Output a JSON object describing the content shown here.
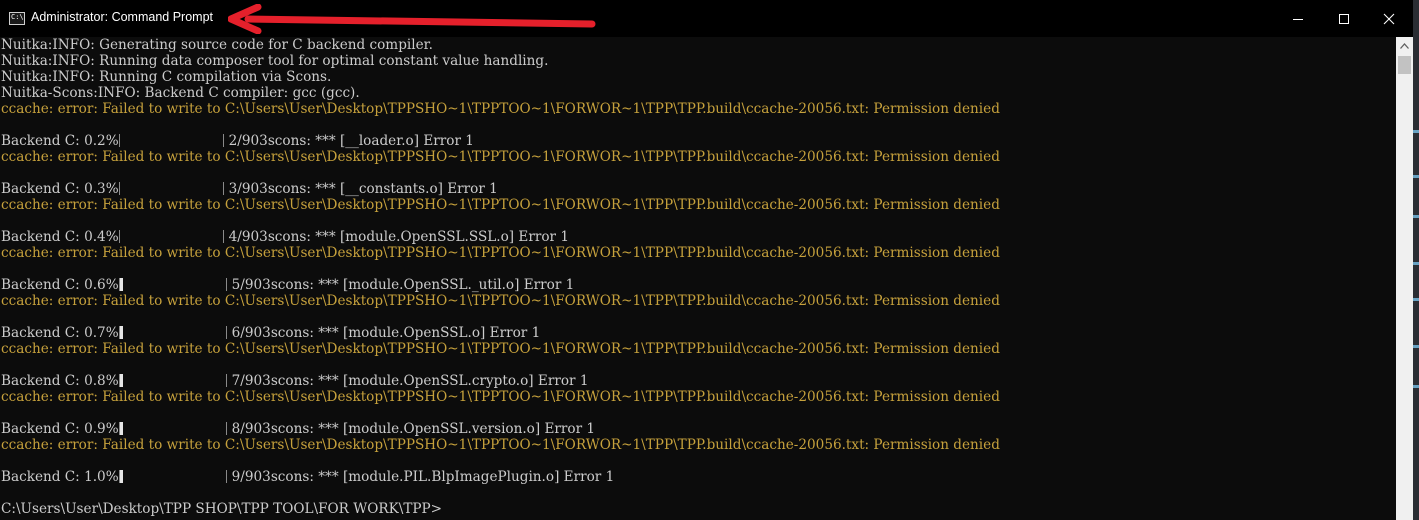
{
  "window": {
    "title": "Administrator: Command Prompt",
    "icon": "cmd-icon",
    "icon_text": "C:\\",
    "controls": [
      "minimize-icon",
      "maximize-icon",
      "close-icon"
    ]
  },
  "annotation": {
    "arrow_color": "#e5202b"
  },
  "colors": {
    "console_bg": "#0c0c0c",
    "console_text": "#cccccc",
    "error_text": "#c6a13c",
    "titlebar_bg": "#000000"
  },
  "console": {
    "lines": [
      {
        "kind": "info",
        "text": "Nuitka:INFO: Generating source code for C backend compiler."
      },
      {
        "kind": "info",
        "text": "Nuitka:INFO: Running data composer tool for optimal constant value handling."
      },
      {
        "kind": "info",
        "text": "Nuitka:INFO: Running C compilation via Scons."
      },
      {
        "kind": "info",
        "text": "Nuitka-Scons:INFO: Backend C compiler: gcc (gcc)."
      },
      {
        "kind": "error",
        "text": "ccache: error: Failed to write to C:\\Users\\User\\Desktop\\TPPSHO~1\\TPPTOO~1\\FORWOR~1\\TPP\\TPP.build\\ccache-20056.txt: Permission denied"
      },
      {
        "kind": "blank",
        "text": ""
      },
      {
        "kind": "progress",
        "label": "Backend C: 0.2%",
        "fill": 0.002,
        "pad": "                        ",
        "suffix": "2/903scons: *** [__loader.o] Error 1"
      },
      {
        "kind": "error",
        "text": "ccache: error: Failed to write to C:\\Users\\User\\Desktop\\TPPSHO~1\\TPPTOO~1\\FORWOR~1\\TPP\\TPP.build\\ccache-20056.txt: Permission denied"
      },
      {
        "kind": "blank",
        "text": ""
      },
      {
        "kind": "progress",
        "label": "Backend C: 0.3%",
        "fill": 0.003,
        "pad": "                        ",
        "suffix": "3/903scons: *** [__constants.o] Error 1"
      },
      {
        "kind": "error",
        "text": "ccache: error: Failed to write to C:\\Users\\User\\Desktop\\TPPSHO~1\\TPPTOO~1\\FORWOR~1\\TPP\\TPP.build\\ccache-20056.txt: Permission denied"
      },
      {
        "kind": "blank",
        "text": ""
      },
      {
        "kind": "progress",
        "label": "Backend C: 0.4%",
        "fill": 0.004,
        "pad": "                        ",
        "suffix": "4/903scons: *** [module.OpenSSL.SSL.o] Error 1"
      },
      {
        "kind": "error",
        "text": "ccache: error: Failed to write to C:\\Users\\User\\Desktop\\TPPSHO~1\\TPPTOO~1\\FORWOR~1\\TPP\\TPP.build\\ccache-20056.txt: Permission denied"
      },
      {
        "kind": "blank",
        "text": ""
      },
      {
        "kind": "progress",
        "label": "Backend C: 0.6%",
        "fill": 0.006,
        "pad": "                        ",
        "suffix": "5/903scons: *** [module.OpenSSL._util.o] Error 1"
      },
      {
        "kind": "error",
        "text": "ccache: error: Failed to write to C:\\Users\\User\\Desktop\\TPPSHO~1\\TPPTOO~1\\FORWOR~1\\TPP\\TPP.build\\ccache-20056.txt: Permission denied"
      },
      {
        "kind": "blank",
        "text": ""
      },
      {
        "kind": "progress",
        "label": "Backend C: 0.7%",
        "fill": 0.007,
        "pad": "                        ",
        "suffix": "6/903scons: *** [module.OpenSSL.o] Error 1"
      },
      {
        "kind": "error",
        "text": "ccache: error: Failed to write to C:\\Users\\User\\Desktop\\TPPSHO~1\\TPPTOO~1\\FORWOR~1\\TPP\\TPP.build\\ccache-20056.txt: Permission denied"
      },
      {
        "kind": "blank",
        "text": ""
      },
      {
        "kind": "progress",
        "label": "Backend C: 0.8%",
        "fill": 0.008,
        "pad": "                        ",
        "suffix": "7/903scons: *** [module.OpenSSL.crypto.o] Error 1"
      },
      {
        "kind": "error",
        "text": "ccache: error: Failed to write to C:\\Users\\User\\Desktop\\TPPSHO~1\\TPPTOO~1\\FORWOR~1\\TPP\\TPP.build\\ccache-20056.txt: Permission denied"
      },
      {
        "kind": "blank",
        "text": ""
      },
      {
        "kind": "progress",
        "label": "Backend C: 0.9%",
        "fill": 0.009,
        "pad": "                        ",
        "suffix": "8/903scons: *** [module.OpenSSL.version.o] Error 1"
      },
      {
        "kind": "error",
        "text": "ccache: error: Failed to write to C:\\Users\\User\\Desktop\\TPPSHO~1\\TPPTOO~1\\FORWOR~1\\TPP\\TPP.build\\ccache-20056.txt: Permission denied"
      },
      {
        "kind": "blank",
        "text": ""
      },
      {
        "kind": "progress",
        "label": "Backend C: 1.0%",
        "fill": 0.01,
        "pad": "                        ",
        "suffix": "9/903scons: *** [module.PIL.BlpImagePlugin.o] Error 1"
      },
      {
        "kind": "blank",
        "text": ""
      },
      {
        "kind": "prompt",
        "text": "C:\\Users\\User\\Desktop\\TPP SHOP\\TPP TOOL\\FOR WORK\\TPP>"
      }
    ]
  }
}
